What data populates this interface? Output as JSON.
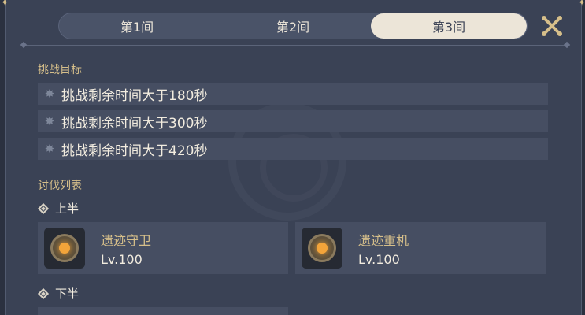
{
  "tabs": [
    {
      "label": "第1间",
      "active": false
    },
    {
      "label": "第2间",
      "active": false
    },
    {
      "label": "第3间",
      "active": true
    }
  ],
  "close_icon": "close-x-icon",
  "objectives": {
    "title": "挑战目标",
    "items": [
      "挑战剩余时间大于180秒",
      "挑战剩余时间大于300秒",
      "挑战剩余时间大于420秒"
    ]
  },
  "enemy_list": {
    "title": "讨伐列表",
    "first_half": {
      "label": "上半",
      "enemies": [
        {
          "name": "遗迹守卫",
          "level": "Lv.100"
        },
        {
          "name": "遗迹重机",
          "level": "Lv.100"
        }
      ]
    },
    "second_half": {
      "label": "下半"
    }
  },
  "colors": {
    "accent": "#d6bf8a",
    "panel": "#3a4255",
    "tab_active": "#ece5d8"
  }
}
